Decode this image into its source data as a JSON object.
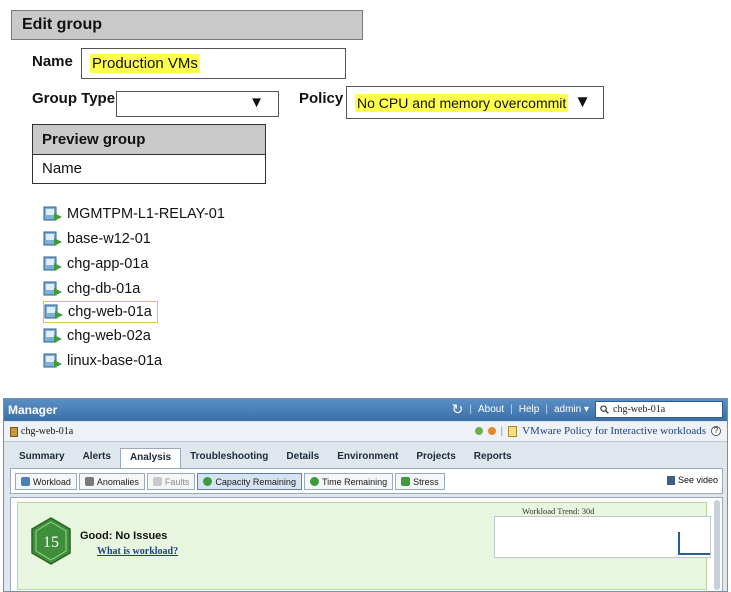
{
  "edit_group": {
    "title": "Edit group",
    "name_label": "Name",
    "name_value": "Production VMs",
    "group_type_label": "Group Type",
    "group_type_value": "",
    "policy_label": "Policy",
    "policy_value": "No CPU and memory overcommit",
    "dropdown_glyph": "▼"
  },
  "preview_group": {
    "title": "Preview group",
    "column_header": "Name",
    "items": [
      {
        "label": "MGMTPM-L1-RELAY-01",
        "selected": false
      },
      {
        "label": "base-w12-01",
        "selected": false
      },
      {
        "label": "chg-app-01a",
        "selected": false
      },
      {
        "label": "chg-db-01a",
        "selected": false
      },
      {
        "label": "chg-web-01a",
        "selected": true
      },
      {
        "label": "chg-web-02a",
        "selected": false
      },
      {
        "label": "linux-base-01a",
        "selected": false
      }
    ]
  },
  "manager": {
    "title": "Manager",
    "about": "About",
    "help": "Help",
    "user": "admin ▾",
    "search_value": "chg-web-01a",
    "breadcrumb": "chg-web-01a",
    "policy_link": "VMware Policy for Interactive workloads",
    "tabs": [
      "Summary",
      "Alerts",
      "Analysis",
      "Troubleshooting",
      "Details",
      "Environment",
      "Projects",
      "Reports"
    ],
    "active_tab": "Analysis",
    "subtabs": [
      "Workload",
      "Anomalies",
      "Faults",
      "Capacity Remaining",
      "Time Remaining",
      "Stress"
    ],
    "active_subtab": "Capacity Remaining",
    "see_video": "See video",
    "badge_value": "15",
    "status_title": "Good: No Issues",
    "what_link": "What is workload?",
    "trend_label": "Workload Trend: 30d"
  },
  "colors": {
    "highlight": "#ffff4d",
    "title_bar": "#4a7fb8",
    "badge_green": "#3f8f3a",
    "status_bg": "#e9f6df"
  }
}
